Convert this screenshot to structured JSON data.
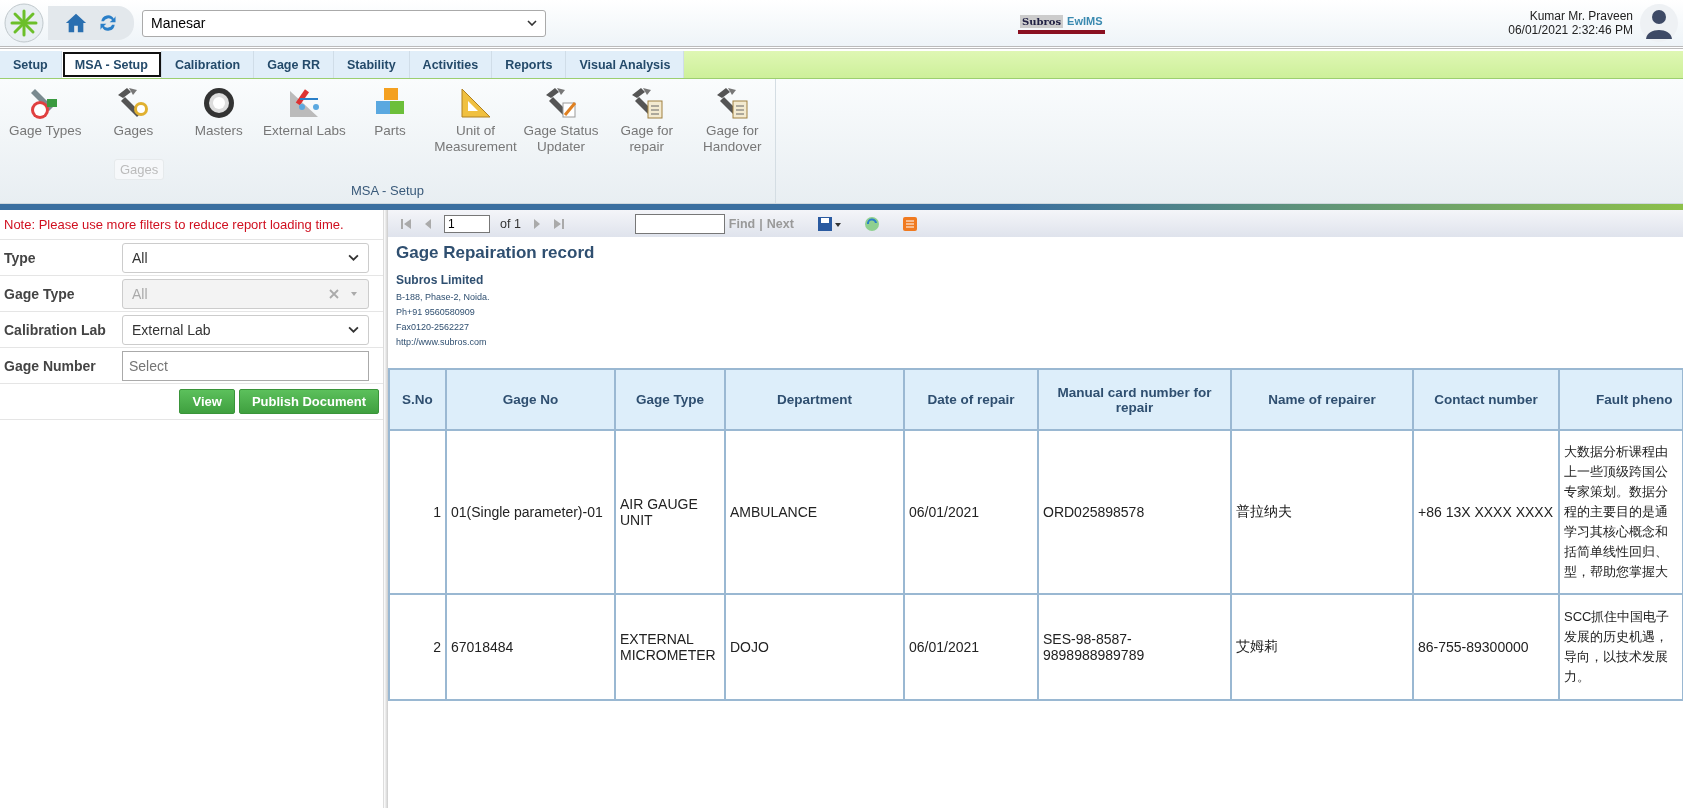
{
  "header": {
    "location": "Manesar",
    "logo": {
      "left": "Subros",
      "right": "EwIMS"
    },
    "user_name": "Kumar Mr. Praveen",
    "datetime": "06/01/2021 2:32:46 PM"
  },
  "tabs": [
    {
      "label": "Setup",
      "selected": false
    },
    {
      "label": "MSA - Setup",
      "selected": true
    },
    {
      "label": "Calibration",
      "selected": false
    },
    {
      "label": "Gage RR",
      "selected": false
    },
    {
      "label": "Stability",
      "selected": false
    },
    {
      "label": "Activities",
      "selected": false
    },
    {
      "label": "Reports",
      "selected": false
    },
    {
      "label": "Visual Analysis",
      "selected": false
    }
  ],
  "ribbon": {
    "group_label": "MSA - Setup",
    "tooltip": "Gages",
    "items": [
      {
        "label": "Gage Types",
        "kind": "gauge"
      },
      {
        "label": "Gages",
        "kind": "caliper"
      },
      {
        "label": "Masters",
        "kind": "ring"
      },
      {
        "label": "External Labs",
        "kind": "lab"
      },
      {
        "label": "Parts",
        "kind": "blocks"
      },
      {
        "label": "Unit of Measurement",
        "kind": "square"
      },
      {
        "label": "Gage Status Updater",
        "kind": "caliper-edit"
      },
      {
        "label": "Gage for repair",
        "kind": "caliper-list"
      },
      {
        "label": "Gage for Handover",
        "kind": "caliper-list"
      }
    ]
  },
  "filters": {
    "note": "Note: Please use more filters to reduce report loading time.",
    "fields": [
      {
        "label": "Type",
        "kind": "select",
        "value": "All",
        "disabled": false
      },
      {
        "label": "Gage Type",
        "kind": "combo",
        "value": "All",
        "disabled": true
      },
      {
        "label": "Calibration Lab",
        "kind": "select",
        "value": "External Lab",
        "disabled": false
      },
      {
        "label": "Gage Number",
        "kind": "input",
        "placeholder": "Select"
      }
    ],
    "buttons": [
      "View",
      "Publish Document"
    ]
  },
  "report_toolbar": {
    "page": "1",
    "of": "of 1",
    "find": "Find",
    "separator": "|",
    "next": "Next"
  },
  "report": {
    "title": "Gage Repairation record",
    "company": "Subros Limited",
    "address_lines": [
      "B-188, Phase-2, Noida.",
      "Ph+91 9560580909",
      "Fax0120-2562227",
      "http://www.subros.com"
    ]
  },
  "table": {
    "columns": [
      "S.No",
      "Gage No",
      "Gage Type",
      "Department",
      "Date of repair",
      "Manual card number for repair",
      "Name of repairer",
      "Contact number",
      "Fault pheno"
    ],
    "rows": [
      {
        "cells": [
          "1",
          "01(Single parameter)-01",
          "AIR GAUGE UNIT",
          "AMBULANCE",
          "06/01/2021",
          "ORD025898578",
          "普拉纳夫",
          "+86 13X XXXX XXXX"
        ],
        "fault_lines": [
          "大数据分析课程由",
          "上一些顶级跨国公",
          "专家策划。数据分",
          "程的主要目的是通",
          "学习其核心概念和",
          "括简单线性回归、",
          "型，帮助您掌握大"
        ]
      },
      {
        "cells": [
          "2",
          "67018484",
          "EXTERNAL MICROMETER",
          "DOJO",
          "06/01/2021",
          "SES-98-8587-9898988989789",
          "艾姆莉",
          "86-755-89300000"
        ],
        "fault_lines": [
          "SCC抓住中国电子",
          "发展的历史机遇，",
          "导向，以技术发展",
          "力。"
        ]
      }
    ]
  }
}
